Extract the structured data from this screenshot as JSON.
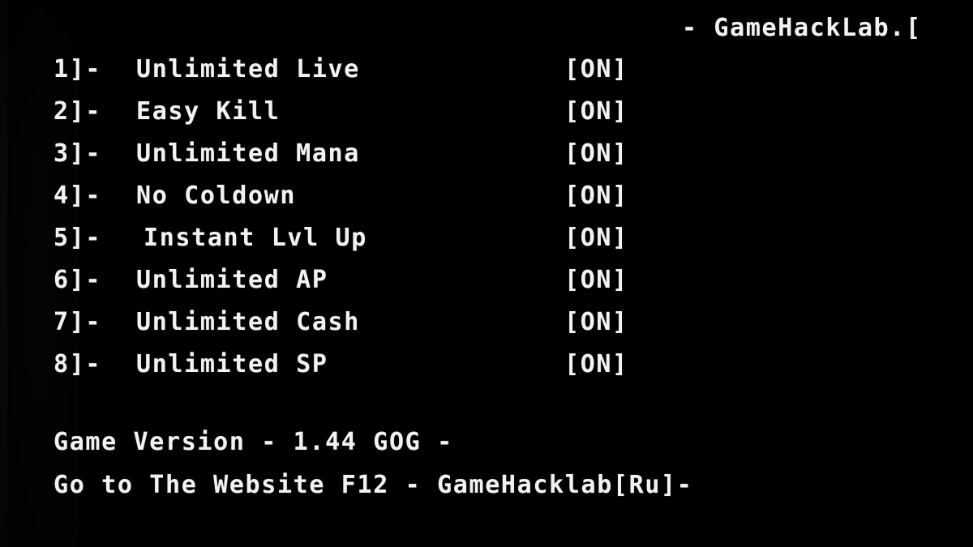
{
  "header": {
    "title": "- GameHackLab.["
  },
  "cheats": {
    "state_label": "[ON]",
    "rows": [
      {
        "key": "1]-",
        "label": "Unlimited Live",
        "state": "[ON]"
      },
      {
        "key": "2]-",
        "label": "Easy Kill",
        "state": "[ON]"
      },
      {
        "key": "3]-",
        "label": "Unlimited Mana",
        "state": "[ON]"
      },
      {
        "key": "4]-",
        "label": "No Coldown",
        "state": "[ON]"
      },
      {
        "key": "5]-",
        "label": "Instant Lvl Up",
        "state": "[ON]"
      },
      {
        "key": "6]-",
        "label": "Unlimited AP",
        "state": "[ON]"
      },
      {
        "key": "7]-",
        "label": "Unlimited Cash",
        "state": "[ON]"
      },
      {
        "key": "8]-",
        "label": "Unlimited SP",
        "state": "[ON]"
      }
    ]
  },
  "footer": {
    "version_line": "Game Version - 1.44 GOG -",
    "website_line": "Go to The Website F12 - GameHacklab[Ru]-"
  },
  "colors": {
    "background": "#000000",
    "text": "#f2f2f2",
    "left_band": "#16161a"
  }
}
